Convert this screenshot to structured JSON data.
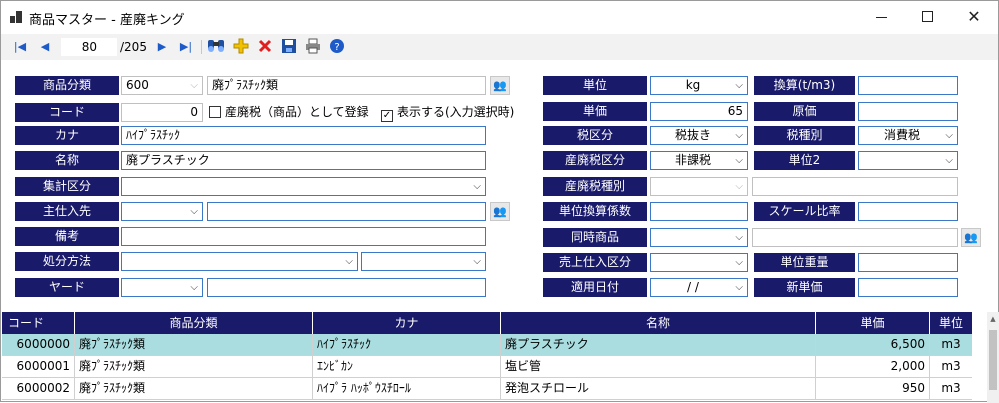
{
  "window": {
    "title": "商品マスター - 産廃キング"
  },
  "toolbar": {
    "record_current": "80",
    "record_total": "/205",
    "icons": [
      "first-record-icon",
      "prev-record-icon",
      "next-record-icon",
      "last-record-icon",
      "search-icon",
      "add-icon",
      "delete-icon",
      "save-icon",
      "print-icon",
      "help-icon"
    ]
  },
  "left": {
    "category_label": "商品分類",
    "category_code": "600",
    "category_name": "廃ﾌﾟﾗｽﾁｯｸ類",
    "code_label": "コード",
    "code_value": "0",
    "tax_register_label": "産廃税（商品）として登録",
    "display_label": "表示する(入力選択時)",
    "display_checked": "✓",
    "kana_label": "カナ",
    "kana_value": "ﾊｲﾌﾟﾗｽﾁｯｸ",
    "name_label": "名称",
    "name_value": "廃プラスチック",
    "summary_label": "集計区分",
    "supplier_label": "主仕入先",
    "note_label": "備考",
    "disposal_label": "処分方法",
    "yard_label": "ヤード"
  },
  "right": {
    "unit_label": "単位",
    "unit_value": "kg",
    "conv_label": "換算(t/m3)",
    "price_label": "単価",
    "price_value": "65",
    "cost_label": "原価",
    "tax_cat_label": "税区分",
    "tax_cat_value": "税抜き",
    "tax_type_label": "税種別",
    "tax_type_value": "消費税",
    "waste_tax_cat_label": "産廃税区分",
    "waste_tax_cat_value": "非課税",
    "unit2_label": "単位2",
    "waste_tax_type_label": "産廃税種別",
    "unit_conv_label": "単位換算係数",
    "scale_label": "スケール比率",
    "same_time_label": "同時商品",
    "sales_purchase_label": "売上仕入区分",
    "unit_weight_label": "単位重量",
    "apply_date_label": "適用日付",
    "apply_date_value": "/   /",
    "new_price_label": "新単価"
  },
  "grid": {
    "headers": [
      "コード",
      "商品分類",
      "カナ",
      "名称",
      "単価",
      "単位"
    ],
    "rows": [
      [
        "6000000",
        "廃ﾌﾟﾗｽﾁｯｸ類",
        "ﾊｲﾌﾟﾗｽﾁｯｸ",
        "廃プラスチック",
        "6,500",
        "m3"
      ],
      [
        "6000001",
        "廃ﾌﾟﾗｽﾁｯｸ類",
        "ｴﾝﾋﾞｶﾝ",
        "塩ビ管",
        "2,000",
        "m3"
      ],
      [
        "6000002",
        "廃ﾌﾟﾗｽﾁｯｸ類",
        "ﾊｲﾌﾟﾗ ﾊｯﾎﾟｳｽﾁﾛｰﾙ",
        "発泡スチロール",
        "950",
        "m3"
      ]
    ]
  },
  "colors": {
    "label_bg": "#1a1a6b",
    "selected_row": "#a9dde0",
    "field_border": "#3c78c8"
  }
}
